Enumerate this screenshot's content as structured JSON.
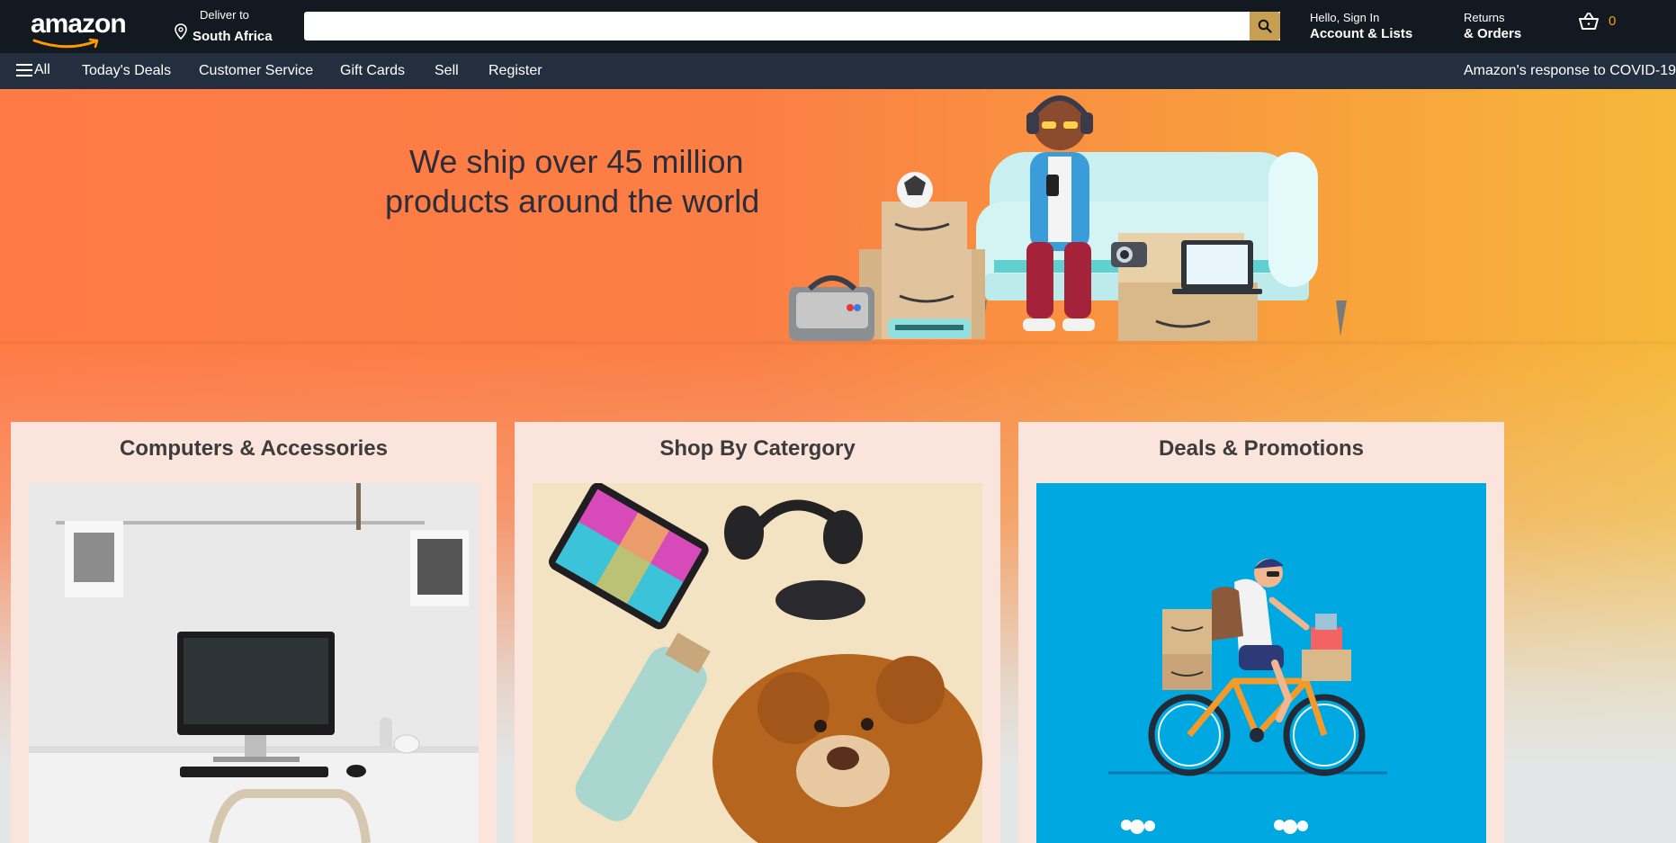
{
  "header": {
    "logo_text": "amazon",
    "deliver_line1": "Deliver to",
    "deliver_line2": "South Africa",
    "search_value": "",
    "account_line1": "Hello, Sign In",
    "account_line2": "Account & Lists",
    "returns_line1": "Returns",
    "returns_line2": "& Orders",
    "cart_count": "0",
    "icons": [
      "location-pin-icon",
      "search-icon",
      "cart-icon"
    ]
  },
  "nav": {
    "all_label": "All",
    "links": [
      "Today's Deals",
      "Customer Service",
      "Gift Cards",
      "Sell",
      "Register"
    ],
    "covid_label": "Amazon's response to COVID-19"
  },
  "hero": {
    "line1": "We ship over 45 million",
    "line2": "products around the world"
  },
  "cards": [
    {
      "title": "Computers & Accessories"
    },
    {
      "title": "Shop By Catergory"
    },
    {
      "title": "Deals & Promotions"
    }
  ],
  "colors": {
    "header_bg": "#131921",
    "nav_bg": "#232f3e",
    "search_button": "#c79f52",
    "cart_count": "#f0a300",
    "hero_orange": "#ff7a45",
    "hero_yellow": "#f6b83a",
    "card_bg": "#fbe4dc",
    "deals_blue": "#00a8e1"
  }
}
